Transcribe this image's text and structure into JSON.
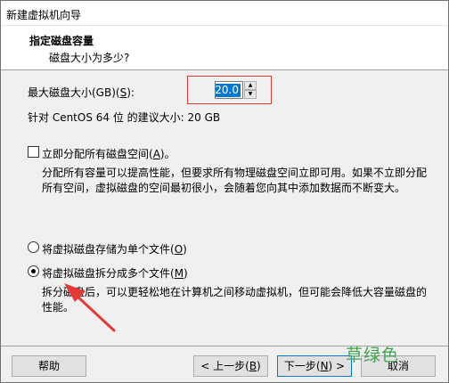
{
  "window": {
    "title": "新建虚拟机向导"
  },
  "header": {
    "title": "指定磁盘容量",
    "subtitle": "磁盘大小为多少?"
  },
  "disk": {
    "label_pre": "最大磁盘大小(GB)(",
    "label_key": "S",
    "label_post": "):",
    "value": "20.0",
    "recommend": "针对 CentOS 64 位 的建议大小: 20 GB"
  },
  "allocate": {
    "label_pre": "立即分配所有磁盘空间(",
    "label_key": "A",
    "label_post": ")。",
    "checked": false,
    "desc_line1": "分配所有容量可以提高性能，但要求所有物理磁盘空间立即可用。如果不立即分配",
    "desc_line2": "所有空间，虚拟磁盘的空间最初很小，会随着您向其中添加数据而不断变大。"
  },
  "single_file": {
    "label_pre": "将虚拟磁盘存储为单个文件(",
    "label_key": "O",
    "label_post": ")",
    "checked": false
  },
  "multi_file": {
    "label_pre": "将虚拟磁盘拆分成多个文件(",
    "label_key": "M",
    "label_post": ")",
    "checked": true,
    "desc_line1": "拆分磁盘后，可以更轻松地在计算机之间移动虚拟机，但可能会降低大容量磁盘的",
    "desc_line2": "性能。"
  },
  "buttons": {
    "help": "帮助",
    "back_pre": "< 上一步(",
    "back_key": "B",
    "back_post": ")",
    "next_pre": "下一步(",
    "next_key": "N",
    "next_post": ") >",
    "cancel": "取消"
  },
  "watermark": "草绿色",
  "annotation_color": "#e53935"
}
